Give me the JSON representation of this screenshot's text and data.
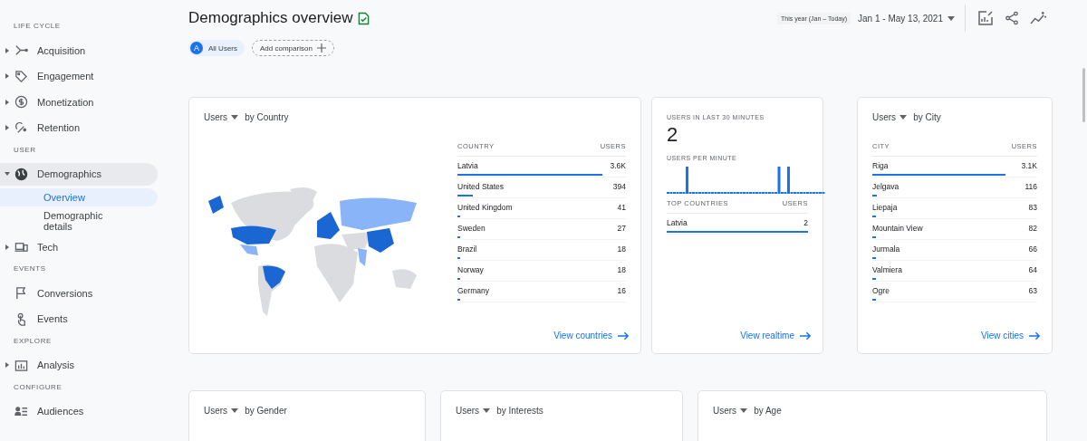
{
  "sidebar": {
    "sections": [
      {
        "heading": "LIFE CYCLE",
        "items": [
          {
            "label": "Acquisition",
            "expandable": true,
            "expanded": false,
            "selected": false
          },
          {
            "label": "Engagement",
            "expandable": true,
            "expanded": false,
            "selected": false
          },
          {
            "label": "Monetization",
            "expandable": true,
            "expanded": false,
            "selected": false
          },
          {
            "label": "Retention",
            "expandable": true,
            "expanded": false,
            "selected": false
          }
        ]
      },
      {
        "heading": "USER",
        "items": [
          {
            "label": "Demographics",
            "expandable": true,
            "expanded": true,
            "selected": false,
            "children": [
              {
                "label": "Overview",
                "selected": true
              },
              {
                "label": "Demographic details",
                "selected": false
              }
            ]
          },
          {
            "label": "Tech",
            "expandable": true,
            "expanded": false,
            "selected": false
          }
        ]
      },
      {
        "heading": "EVENTS",
        "items": [
          {
            "label": "Conversions",
            "expandable": false,
            "expanded": false,
            "selected": false
          },
          {
            "label": "Events",
            "expandable": false,
            "expanded": false,
            "selected": false
          }
        ]
      },
      {
        "heading": "EXPLORE",
        "items": [
          {
            "label": "Analysis",
            "expandable": true,
            "expanded": false,
            "selected": false
          }
        ]
      },
      {
        "heading": "CONFIGURE",
        "items": [
          {
            "label": "Audiences",
            "expandable": false,
            "expanded": false,
            "selected": false
          }
        ]
      }
    ]
  },
  "header": {
    "title": "Demographics overview",
    "date_preset": "This year (Jan – Today)",
    "date_range": "Jan 1 - May 13, 2021",
    "segment_letter": "A",
    "segment": "All Users",
    "add_comparison": "Add comparison"
  },
  "country_card": {
    "metric": "Users",
    "dimension": "by Country",
    "columns": [
      "COUNTRY",
      "USERS"
    ],
    "rows": [
      {
        "name": "Latvia",
        "value": "3.6K",
        "level": 0.86
      },
      {
        "name": "United States",
        "value": "394",
        "level": 0.09
      },
      {
        "name": "United Kingdom",
        "value": "41",
        "level": 0.01
      },
      {
        "name": "Sweden",
        "value": "27",
        "level": 0.01
      },
      {
        "name": "Brazil",
        "value": "18",
        "level": 0.01
      },
      {
        "name": "Norway",
        "value": "18",
        "level": 0.01
      },
      {
        "name": "Germany",
        "value": "16",
        "level": 0.01
      }
    ],
    "link": "View countries"
  },
  "realtime_card": {
    "heading": "USERS IN LAST 30 MINUTES",
    "count": "2",
    "per_minute_label": "USERS PER MINUTE",
    "columns": [
      "TOP COUNTRIES",
      "USERS"
    ],
    "rows": [
      {
        "name": "Latvia",
        "value": "2",
        "level": 1.0
      }
    ],
    "link": "View realtime"
  },
  "city_card": {
    "metric": "Users",
    "dimension": "by City",
    "columns": [
      "CITY",
      "USERS"
    ],
    "rows": [
      {
        "name": "Riga",
        "value": "3.1K",
        "level": 0.81
      },
      {
        "name": "Jelgava",
        "value": "116",
        "level": 0.03
      },
      {
        "name": "Liepaja",
        "value": "83",
        "level": 0.02
      },
      {
        "name": "Mountain View",
        "value": "82",
        "level": 0.02
      },
      {
        "name": "Jurmala",
        "value": "66",
        "level": 0.02
      },
      {
        "name": "Valmiera",
        "value": "64",
        "level": 0.02
      },
      {
        "name": "Ogre",
        "value": "63",
        "level": 0.02
      }
    ],
    "link": "View cities"
  },
  "bottom_cards": [
    {
      "metric": "Users",
      "dimension": "by Gender"
    },
    {
      "metric": "Users",
      "dimension": "by Interests"
    },
    {
      "metric": "Users",
      "dimension": "by Age"
    }
  ]
}
